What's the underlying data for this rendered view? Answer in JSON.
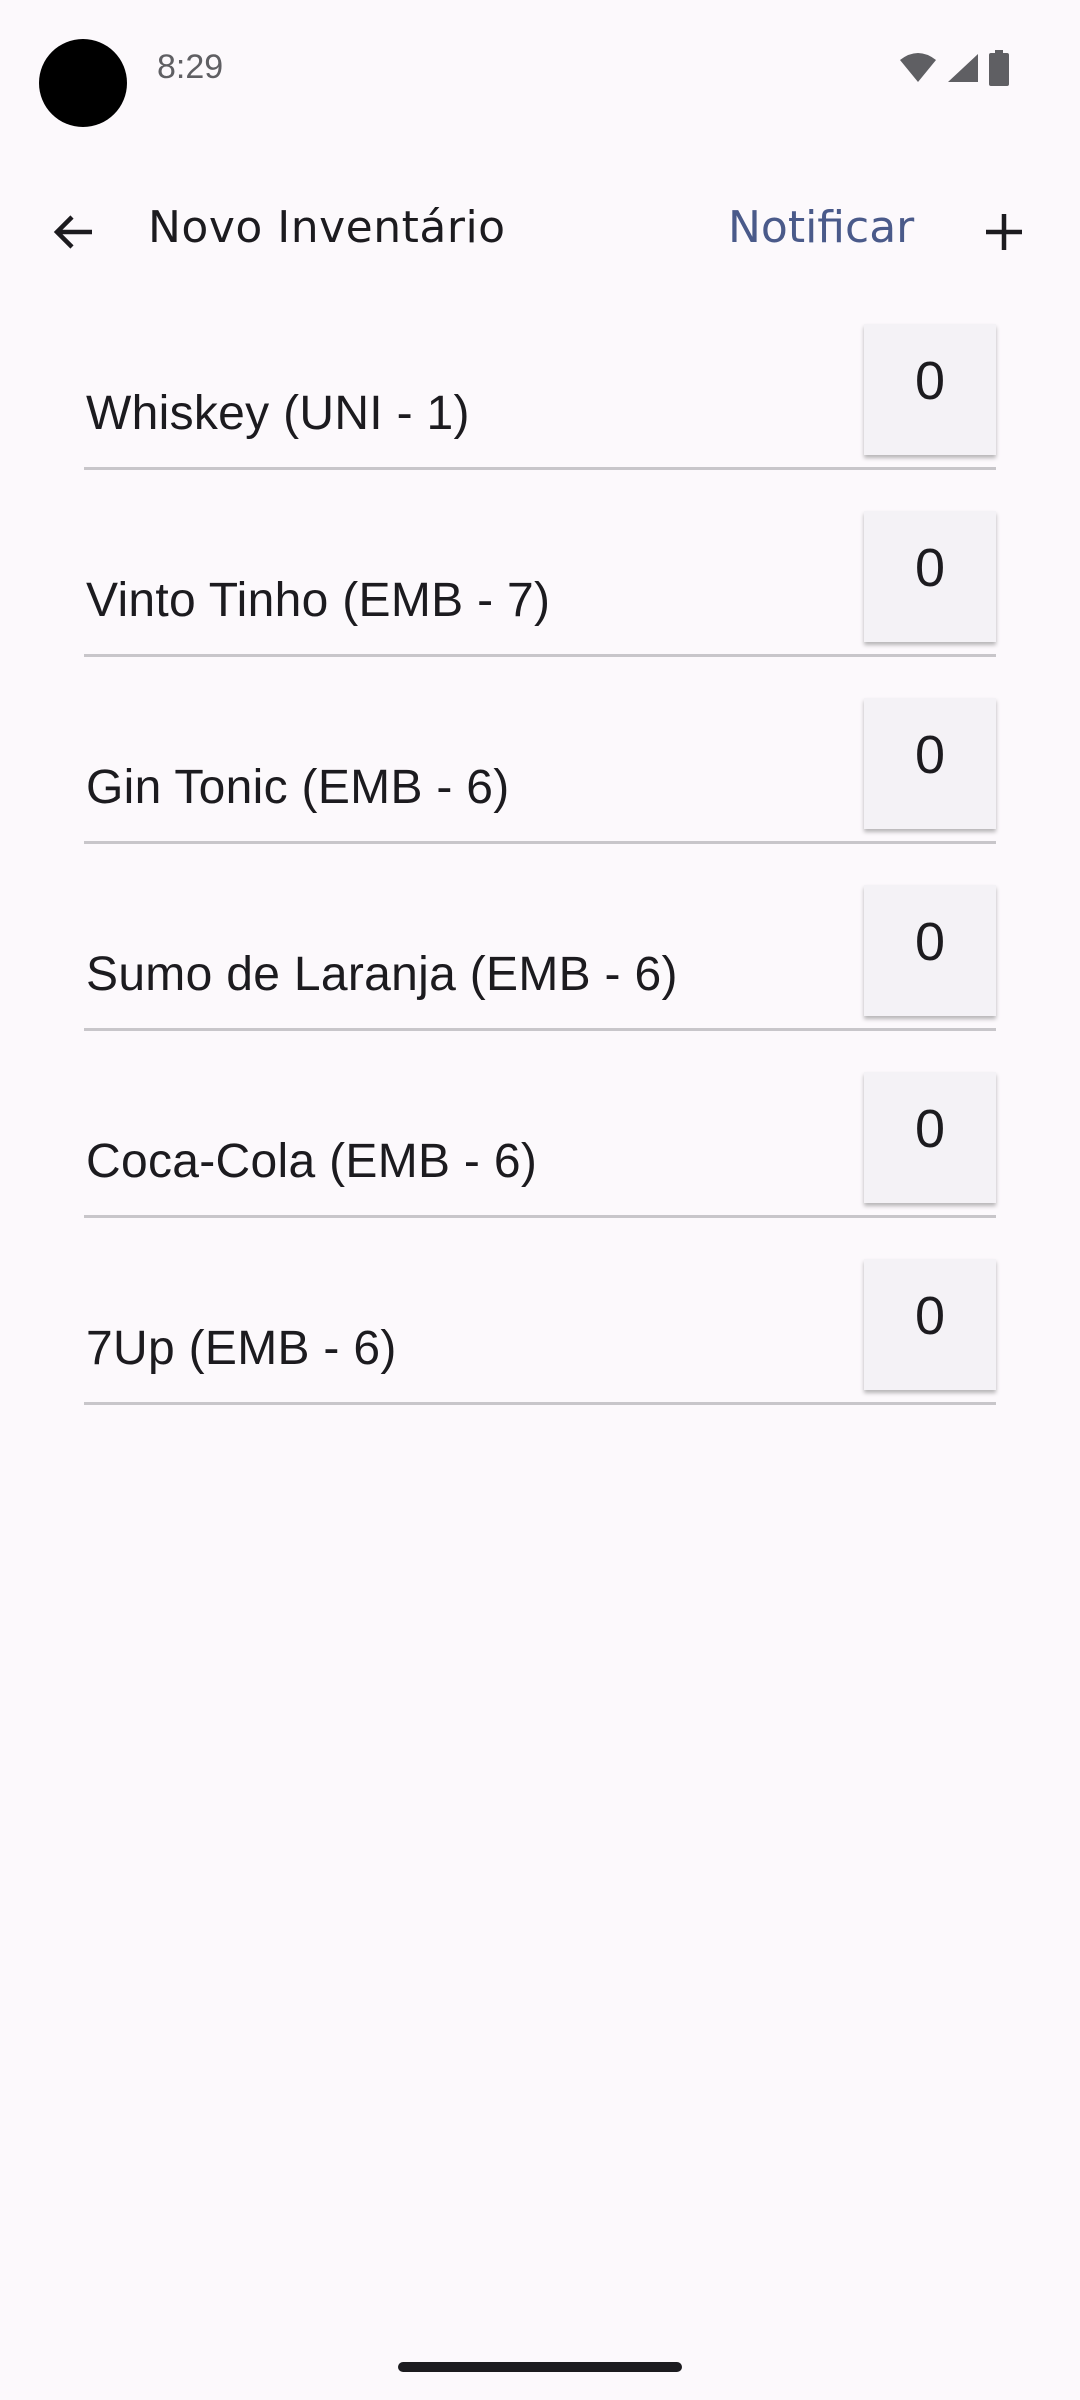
{
  "status_bar": {
    "time": "8:29",
    "icons": [
      "wifi-icon",
      "signal-icon",
      "battery-icon"
    ]
  },
  "app_bar": {
    "back_icon": "arrow-left-icon",
    "title": "Novo Inventário",
    "notify_label": "Notificar",
    "add_icon": "plus-icon"
  },
  "inventory": {
    "items": [
      {
        "label": "Whiskey (UNI - 1)",
        "quantity": "0"
      },
      {
        "label": "Vinto Tinho (EMB - 7)",
        "quantity": "0"
      },
      {
        "label": "Gin Tonic (EMB - 6)",
        "quantity": "0"
      },
      {
        "label": "Sumo de Laranja (EMB - 6)",
        "quantity": "0"
      },
      {
        "label": "Coca-Cola (EMB - 6)",
        "quantity": "0"
      },
      {
        "label": "7Up (EMB - 6)",
        "quantity": "0"
      }
    ]
  },
  "colors": {
    "background": "#fcf9fc",
    "accent": "#4a5a8a",
    "text": "#1c1b1f",
    "input_bg": "#f4f2f6",
    "divider": "#c8c6ca"
  }
}
